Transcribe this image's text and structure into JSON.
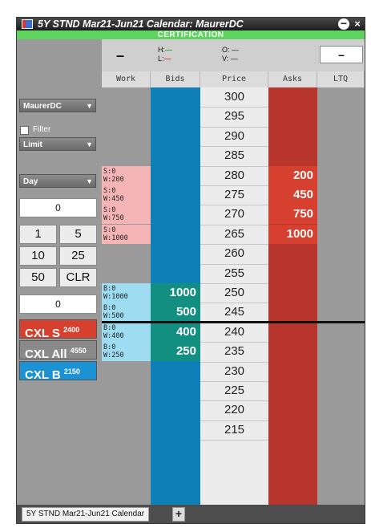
{
  "window": {
    "title": "5Y STND Mar21-Jun21 Calendar: MaurerDC",
    "banner": "CERTIFICATION",
    "minimize_glyph": "−",
    "close_glyph": "×"
  },
  "stats": {
    "dash_left": "–",
    "h_label": "H:",
    "h_value": "—",
    "l_label": "L:",
    "l_value": "—",
    "o_label": "O:",
    "o_value": "—",
    "v_label": "V:",
    "v_value": "—",
    "box_value": "–"
  },
  "columns": [
    "Work",
    "Bids",
    "Price",
    "Asks",
    "LTQ"
  ],
  "ladder": {
    "prices": [
      "300",
      "295",
      "290",
      "285",
      "280",
      "275",
      "270",
      "265",
      "260",
      "255",
      "250",
      "245",
      "240",
      "235",
      "230",
      "225",
      "220",
      "215"
    ],
    "asks": [
      {
        "price": "280",
        "qty": "200"
      },
      {
        "price": "275",
        "qty": "450"
      },
      {
        "price": "270",
        "qty": "750"
      },
      {
        "price": "265",
        "qty": "1000"
      }
    ],
    "bids": [
      {
        "price": "250",
        "qty": "1000"
      },
      {
        "price": "245",
        "qty": "500"
      },
      {
        "price": "240",
        "qty": "400"
      },
      {
        "price": "235",
        "qty": "250"
      }
    ],
    "work_sell": [
      {
        "l1": "S:0",
        "l2": "W:200"
      },
      {
        "l1": "S:0",
        "l2": "W:450"
      },
      {
        "l1": "S:0",
        "l2": "W:750"
      },
      {
        "l1": "S:0",
        "l2": "W:1000"
      }
    ],
    "work_buy": [
      {
        "l1": "B:0",
        "l2": "W:1000"
      },
      {
        "l1": "B:0",
        "l2": "W:500"
      },
      {
        "l1": "B:0",
        "l2": "W:400"
      },
      {
        "l1": "B:0",
        "l2": "W:250"
      }
    ]
  },
  "controls": {
    "account": "MaurerDC",
    "filter_label": "Filter",
    "order_type": "Limit",
    "tif": "Day",
    "qty_value": "0",
    "qty_buttons": [
      "1",
      "5",
      "10",
      "25",
      "50",
      "CLR"
    ],
    "qty_value2": "0",
    "cxl_s": {
      "label": "CXL S",
      "count": "2400"
    },
    "cxl_all": {
      "label": "CXL All",
      "count": "4550"
    },
    "cxl_b": {
      "label": "CXL B",
      "count": "2150"
    }
  },
  "tabs": {
    "active": "5Y STND Mar21-Jun21 Calendar",
    "add": "+"
  },
  "colors": {
    "bids": "#0f7fb8",
    "asks": "#b7352d",
    "ask_qty": "#d7402f",
    "bid_qty": "#138f82",
    "cert": "#5ed35e"
  }
}
